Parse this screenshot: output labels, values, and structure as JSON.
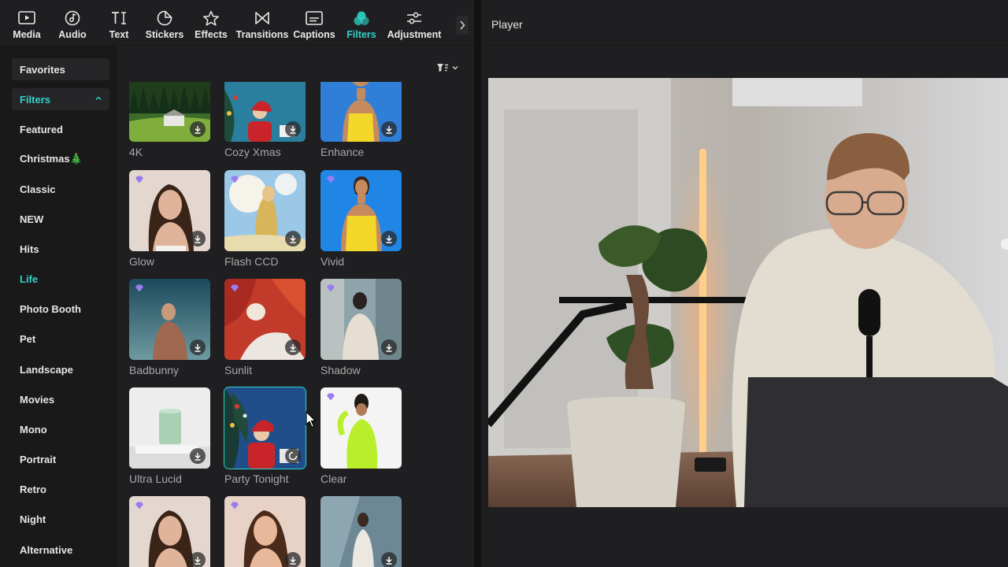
{
  "toolbar": {
    "items": [
      {
        "label": "Media",
        "icon": "media-icon"
      },
      {
        "label": "Audio",
        "icon": "audio-icon"
      },
      {
        "label": "Text",
        "icon": "text-icon"
      },
      {
        "label": "Stickers",
        "icon": "stickers-icon"
      },
      {
        "label": "Effects",
        "icon": "effects-icon"
      },
      {
        "label": "Transitions",
        "icon": "transitions-icon"
      },
      {
        "label": "Captions",
        "icon": "captions-icon"
      },
      {
        "label": "Filters",
        "icon": "filters-icon",
        "active": true
      },
      {
        "label": "Adjustment",
        "icon": "adjustment-icon"
      }
    ]
  },
  "sidebar": {
    "items": [
      {
        "label": "Favorites"
      },
      {
        "label": "Filters",
        "expanded": true
      },
      {
        "label": "Featured"
      },
      {
        "label": "Christmas🎄"
      },
      {
        "label": "Classic"
      },
      {
        "label": "NEW"
      },
      {
        "label": "Hits"
      },
      {
        "label": "Life",
        "active": true
      },
      {
        "label": "Photo Booth"
      },
      {
        "label": "Pet"
      },
      {
        "label": "Landscape"
      },
      {
        "label": "Movies"
      },
      {
        "label": "Mono"
      },
      {
        "label": "Portrait"
      },
      {
        "label": "Retro"
      },
      {
        "label": "Night"
      },
      {
        "label": "Alternative"
      }
    ]
  },
  "filters": [
    {
      "name": "4K",
      "premium": false,
      "status": "download"
    },
    {
      "name": "Cozy Xmas",
      "premium": false,
      "status": "download"
    },
    {
      "name": "Enhance",
      "premium": false,
      "status": "download"
    },
    {
      "name": "Glow",
      "premium": true,
      "status": "download"
    },
    {
      "name": "Flash CCD",
      "premium": true,
      "status": "download"
    },
    {
      "name": "Vivid",
      "premium": true,
      "status": "download"
    },
    {
      "name": "Badbunny",
      "premium": true,
      "status": "download"
    },
    {
      "name": "Sunlit",
      "premium": true,
      "status": "download"
    },
    {
      "name": "Shadow",
      "premium": true,
      "status": "download"
    },
    {
      "name": "Ultra Lucid",
      "premium": false,
      "status": "download"
    },
    {
      "name": "Party Tonight",
      "premium": false,
      "status": "loading",
      "selected": true
    },
    {
      "name": "Clear",
      "premium": true,
      "status": "download"
    },
    {
      "name": "",
      "premium": true,
      "status": "download"
    },
    {
      "name": "",
      "premium": true,
      "status": "download"
    },
    {
      "name": "",
      "premium": false,
      "status": "download"
    }
  ],
  "player": {
    "title": "Player"
  },
  "colors": {
    "accent": "#2fd3c8",
    "panel": "#1f1f21",
    "sidebar": "#19191a",
    "premium": "#9b7cf0"
  }
}
